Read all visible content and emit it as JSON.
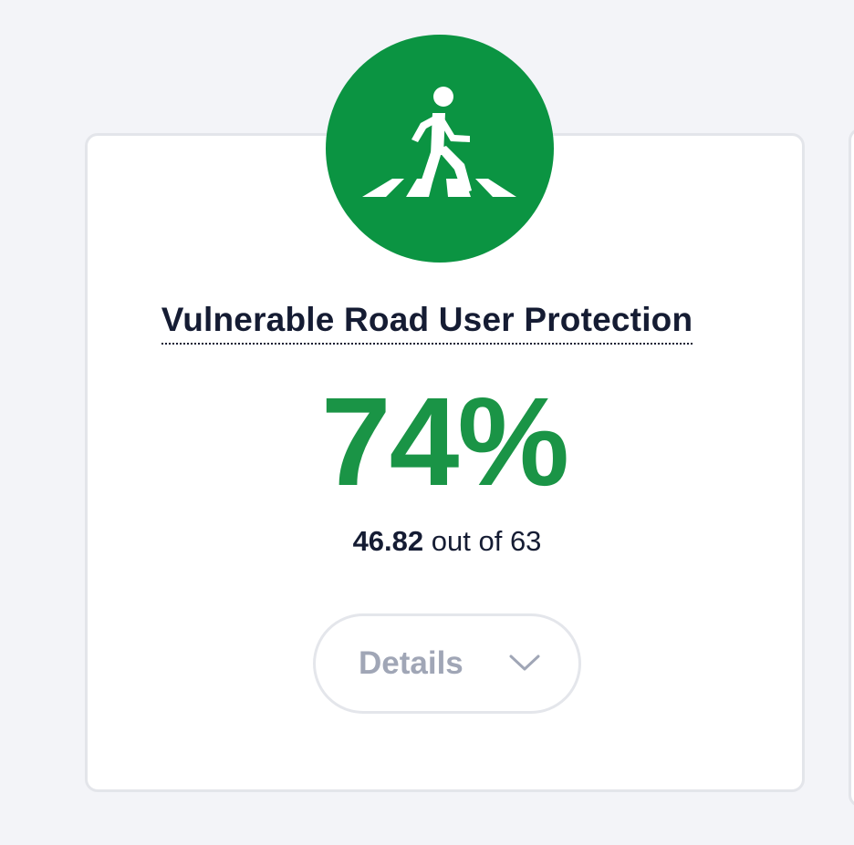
{
  "category": {
    "icon": "pedestrian-crossing-icon",
    "title": "Vulnerable Road User Protection",
    "percent": "74%",
    "score_value": "46.82",
    "score_suffix": "out of 63",
    "score_fraction": 0.743
  },
  "details_button": {
    "label": "Details",
    "icon": "chevron-down-icon"
  },
  "colors": {
    "accent_green": "#0b9442",
    "percent_green": "#1a9446",
    "title_text": "#151c33",
    "button_text": "#a0a6b6",
    "background": "#f3f4f8"
  }
}
